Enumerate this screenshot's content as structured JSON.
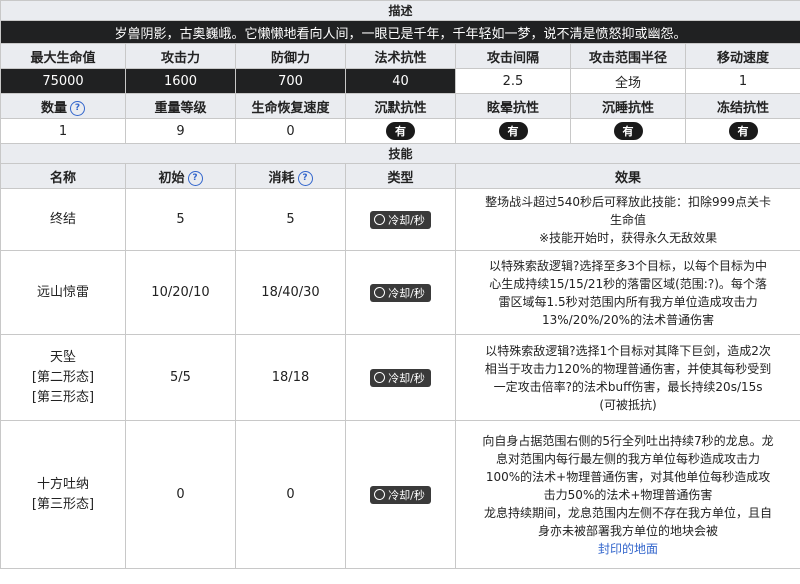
{
  "description_section": {
    "header": "描述",
    "text": "岁兽阴影，古奥巍峨。它懒懒地看向人间，一眼已是千年，千年轻如一梦，说不清是愤怒抑或幽怨。"
  },
  "stats": {
    "headers": [
      "最大生命值",
      "攻击力",
      "防御力",
      "法术抗性",
      "攻击间隔",
      "攻击范围半径",
      "移动速度"
    ],
    "values": [
      "75000",
      "1600",
      "700",
      "40",
      "2.5",
      "全场",
      "1"
    ]
  },
  "stats2": {
    "headers": [
      "数量",
      "重量等级",
      "生命恢复速度",
      "沉默抗性",
      "眩晕抗性",
      "沉睡抗性",
      "冻结抗性"
    ],
    "values": [
      "1",
      "9",
      "0",
      "有",
      "有",
      "有",
      "有"
    ],
    "help_glyph": "?"
  },
  "skills_section": {
    "header": "技能",
    "columns": [
      "名称",
      "初始",
      "消耗",
      "类型",
      "效果"
    ],
    "type_label": "冷却/秒",
    "rows": [
      {
        "name_lines": [
          "终结"
        ],
        "initial": "5",
        "cost": "5",
        "effect_lines": [
          "整场战斗超过540秒后可释放此技能：扣除999点关卡",
          "生命值",
          "※技能开始时，获得永久无敌效果"
        ]
      },
      {
        "name_lines": [
          "远山惊雷"
        ],
        "initial": "10/20/10",
        "cost": "18/40/30",
        "effect_lines": [
          "以特殊索敌逻辑?选择至多3个目标，以每个目标为中",
          "心生成持续15/15/21秒的落雷区域(范围:?)。每个落",
          "雷区域每1.5秒对范围内所有我方单位造成攻击力",
          "13%/20%/20%的法术普通伤害"
        ]
      },
      {
        "name_lines": [
          "天坠",
          "[第二形态]",
          "[第三形态]"
        ],
        "initial": "5/5",
        "cost": "18/18",
        "effect_lines": [
          "以特殊索敌逻辑?选择1个目标对其降下巨剑，造成2次",
          "相当于攻击力120%的物理普通伤害，并使其每秒受到",
          "一定攻击倍率?的法术buff伤害，最长持续20s/15s",
          "(可被抵抗)"
        ]
      },
      {
        "name_lines": [
          "十方吐纳",
          "[第三形态]"
        ],
        "initial": "0",
        "cost": "0",
        "effect_lines": [
          "向自身占据范围右侧的5行全列吐出持续7秒的龙息。龙",
          "息对范围内每行最左侧的我方单位每秒造成攻击力",
          "100%的法术+物理普通伤害，对其他单位每秒造成攻",
          "击力50%的法术+物理普通伤害",
          "龙息持续期间，龙息范围内左侧不存在我方单位，且自",
          "身亦未被部署我方单位的地块会被",
          "封印的地面"
        ]
      }
    ]
  }
}
